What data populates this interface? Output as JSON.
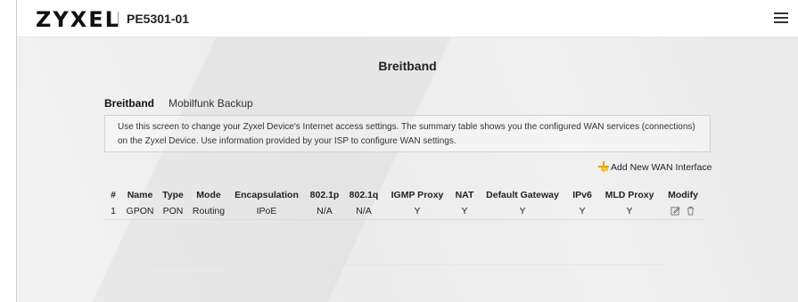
{
  "header": {
    "logo": "ZYXEL",
    "model": "PE5301-01",
    "menu_icon": "hamburger-menu-icon"
  },
  "page": {
    "title": "Breitband"
  },
  "tabs": [
    {
      "label": "Breitband",
      "active": true
    },
    {
      "label": "Mobilfunk Backup",
      "active": false
    }
  ],
  "info": {
    "text": "Use this screen to change your Zyxel Device's Internet access settings. The summary table shows you the configured WAN services (connections) on the Zyxel Device. Use information provided by your ISP to configure WAN settings."
  },
  "actions": {
    "add_wan_label": "Add New WAN Interface"
  },
  "table": {
    "columns": [
      "#",
      "Name",
      "Type",
      "Mode",
      "Encapsulation",
      "802.1p",
      "802.1q",
      "IGMP Proxy",
      "NAT",
      "Default Gateway",
      "IPv6",
      "MLD Proxy",
      "Modify"
    ],
    "rows": [
      [
        "1",
        "GPON",
        "PON",
        "Routing",
        "IPoE",
        "N/A",
        "N/A",
        "Y",
        "Y",
        "Y",
        "Y",
        "Y"
      ]
    ]
  },
  "colors": {
    "accent": "#f5c400",
    "plus": "#e8a100"
  }
}
